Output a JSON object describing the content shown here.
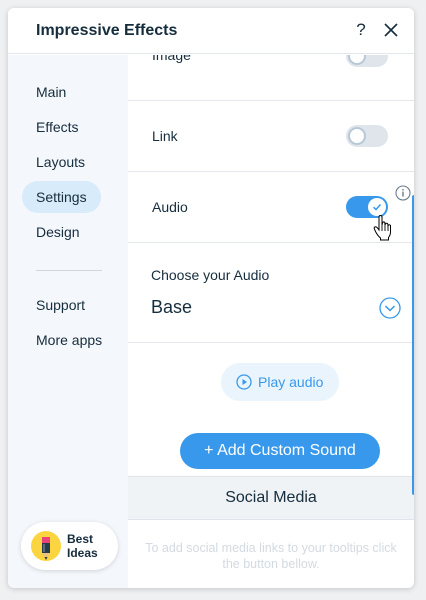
{
  "header": {
    "title": "Impressive Effects",
    "help_label": "?"
  },
  "sidebar": {
    "items": [
      {
        "label": "Main",
        "active": false
      },
      {
        "label": "Effects",
        "active": false
      },
      {
        "label": "Layouts",
        "active": false
      },
      {
        "label": "Settings",
        "active": true
      },
      {
        "label": "Design",
        "active": false
      },
      {
        "label": "Support",
        "active": false
      },
      {
        "label": "More apps",
        "active": false
      }
    ],
    "promo": {
      "line1": "Best",
      "line2": "Ideas"
    }
  },
  "settings": {
    "rows": [
      {
        "label": "Image",
        "enabled": false
      },
      {
        "label": "Link",
        "enabled": false
      },
      {
        "label": "Audio",
        "enabled": true
      }
    ],
    "choose_audio_label": "Choose your Audio",
    "audio_selected": "Base",
    "play_label": "Play audio",
    "add_sound_label": "+ Add Custom Sound"
  },
  "social": {
    "header": "Social Media",
    "hint": "To add social media links to your tooltips click the button bellow."
  },
  "colors": {
    "accent": "#3899ec",
    "selected_nav": "#d7ebfb",
    "sidebar_bg": "#f4f7fb"
  },
  "icons": [
    "help-icon",
    "close-icon",
    "info-icon",
    "chevron-down-icon",
    "play-icon",
    "check-icon",
    "pencil-icon",
    "hand-cursor-icon"
  ]
}
